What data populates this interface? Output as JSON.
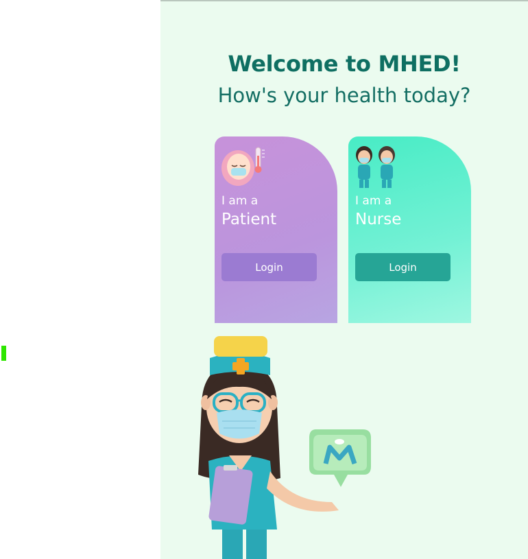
{
  "header": {
    "title": "Welcome to MHED!",
    "subtitle": "How's your health today?"
  },
  "cards": [
    {
      "prefix": "I am a",
      "role": "Patient",
      "login_label": "Login",
      "icon": "patient-thermometer-icon",
      "color": "#c792da"
    },
    {
      "prefix": "I am a",
      "role": "Nurse",
      "login_label": "Login",
      "icon": "nurses-icon",
      "color": "#48ecc5"
    }
  ],
  "illustrations": {
    "hero": "nurse-character",
    "logo": "mhed-logo-bubble"
  }
}
